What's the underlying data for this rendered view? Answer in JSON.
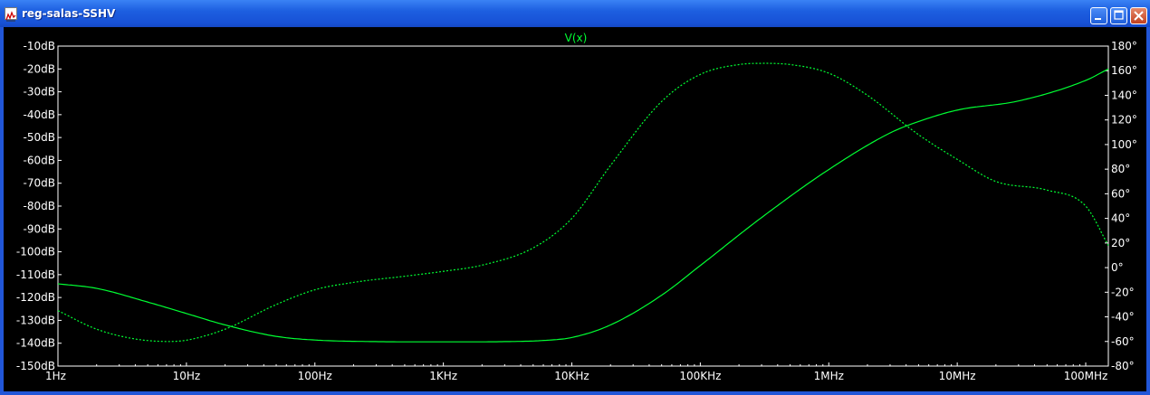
{
  "window": {
    "title": "reg-salas-SSHV",
    "icon": "ltspice-waveform-icon",
    "buttons": [
      "minimize-icon",
      "maximize-icon",
      "close-icon"
    ]
  },
  "colors": {
    "trace": "#00ff33",
    "background": "#000000",
    "axis": "#ffffff",
    "titlebar": "#1d5fe0"
  },
  "chart_data": {
    "type": "line",
    "title": "V(x)",
    "xscale": "log",
    "xlim": [
      1,
      150000000
    ],
    "x_tick_labels": [
      "1Hz",
      "10Hz",
      "100Hz",
      "1KHz",
      "10KHz",
      "100KHz",
      "1MHz",
      "10MHz",
      "100MHz"
    ],
    "x_tick_values": [
      1,
      10,
      100,
      1000,
      10000,
      100000,
      1000000,
      10000000,
      100000000
    ],
    "y_left": {
      "ylim": [
        -150,
        -10
      ],
      "tick_labels": [
        "-10dB",
        "-20dB",
        "-30dB",
        "-40dB",
        "-50dB",
        "-60dB",
        "-70dB",
        "-80dB",
        "-90dB",
        "-100dB",
        "-110dB",
        "-120dB",
        "-130dB",
        "-140dB",
        "-150dB"
      ],
      "tick_values": [
        -10,
        -20,
        -30,
        -40,
        -50,
        -60,
        -70,
        -80,
        -90,
        -100,
        -110,
        -120,
        -130,
        -140,
        -150
      ]
    },
    "y_right": {
      "ylim": [
        -80,
        180
      ],
      "tick_labels": [
        "180°",
        "160°",
        "140°",
        "120°",
        "100°",
        "80°",
        "60°",
        "40°",
        "20°",
        "0°",
        "-20°",
        "-40°",
        "-60°",
        "-80°"
      ],
      "tick_values": [
        180,
        160,
        140,
        120,
        100,
        80,
        60,
        40,
        20,
        0,
        -20,
        -40,
        -60,
        -80
      ]
    },
    "grid": false,
    "series": [
      {
        "style": "solid",
        "axis": "left",
        "x": [
          1,
          2,
          5,
          10,
          20,
          50,
          100,
          300,
          1000,
          3000,
          6000,
          10000,
          20000,
          50000,
          100000,
          300000,
          1000000,
          3000000,
          5000000,
          10000000,
          30000000,
          100000000,
          150000000
        ],
        "values": [
          -114,
          -116,
          -122,
          -127,
          -132,
          -137,
          -138.6,
          -139.3,
          -139.4,
          -139.3,
          -138.8,
          -137.5,
          -132,
          -119,
          -106,
          -85,
          -64,
          -48,
          -43,
          -38,
          -34,
          -25,
          -20
        ]
      },
      {
        "style": "dashed",
        "axis": "right",
        "x": [
          1,
          2,
          4,
          7,
          10,
          20,
          50,
          100,
          200,
          500,
          1000,
          2000,
          5000,
          10000,
          20000,
          50000,
          100000,
          200000,
          300000,
          500000,
          1000000,
          2000000,
          5000000,
          10000000,
          20000000,
          50000000,
          100000000,
          150000000
        ],
        "values": [
          -35,
          -50,
          -58,
          -60,
          -59,
          -50,
          -30,
          -18,
          -12,
          -7,
          -3,
          2,
          16,
          40,
          83,
          135,
          157,
          165,
          166,
          165,
          158,
          140,
          108,
          88,
          70,
          63,
          50,
          18
        ]
      }
    ]
  }
}
